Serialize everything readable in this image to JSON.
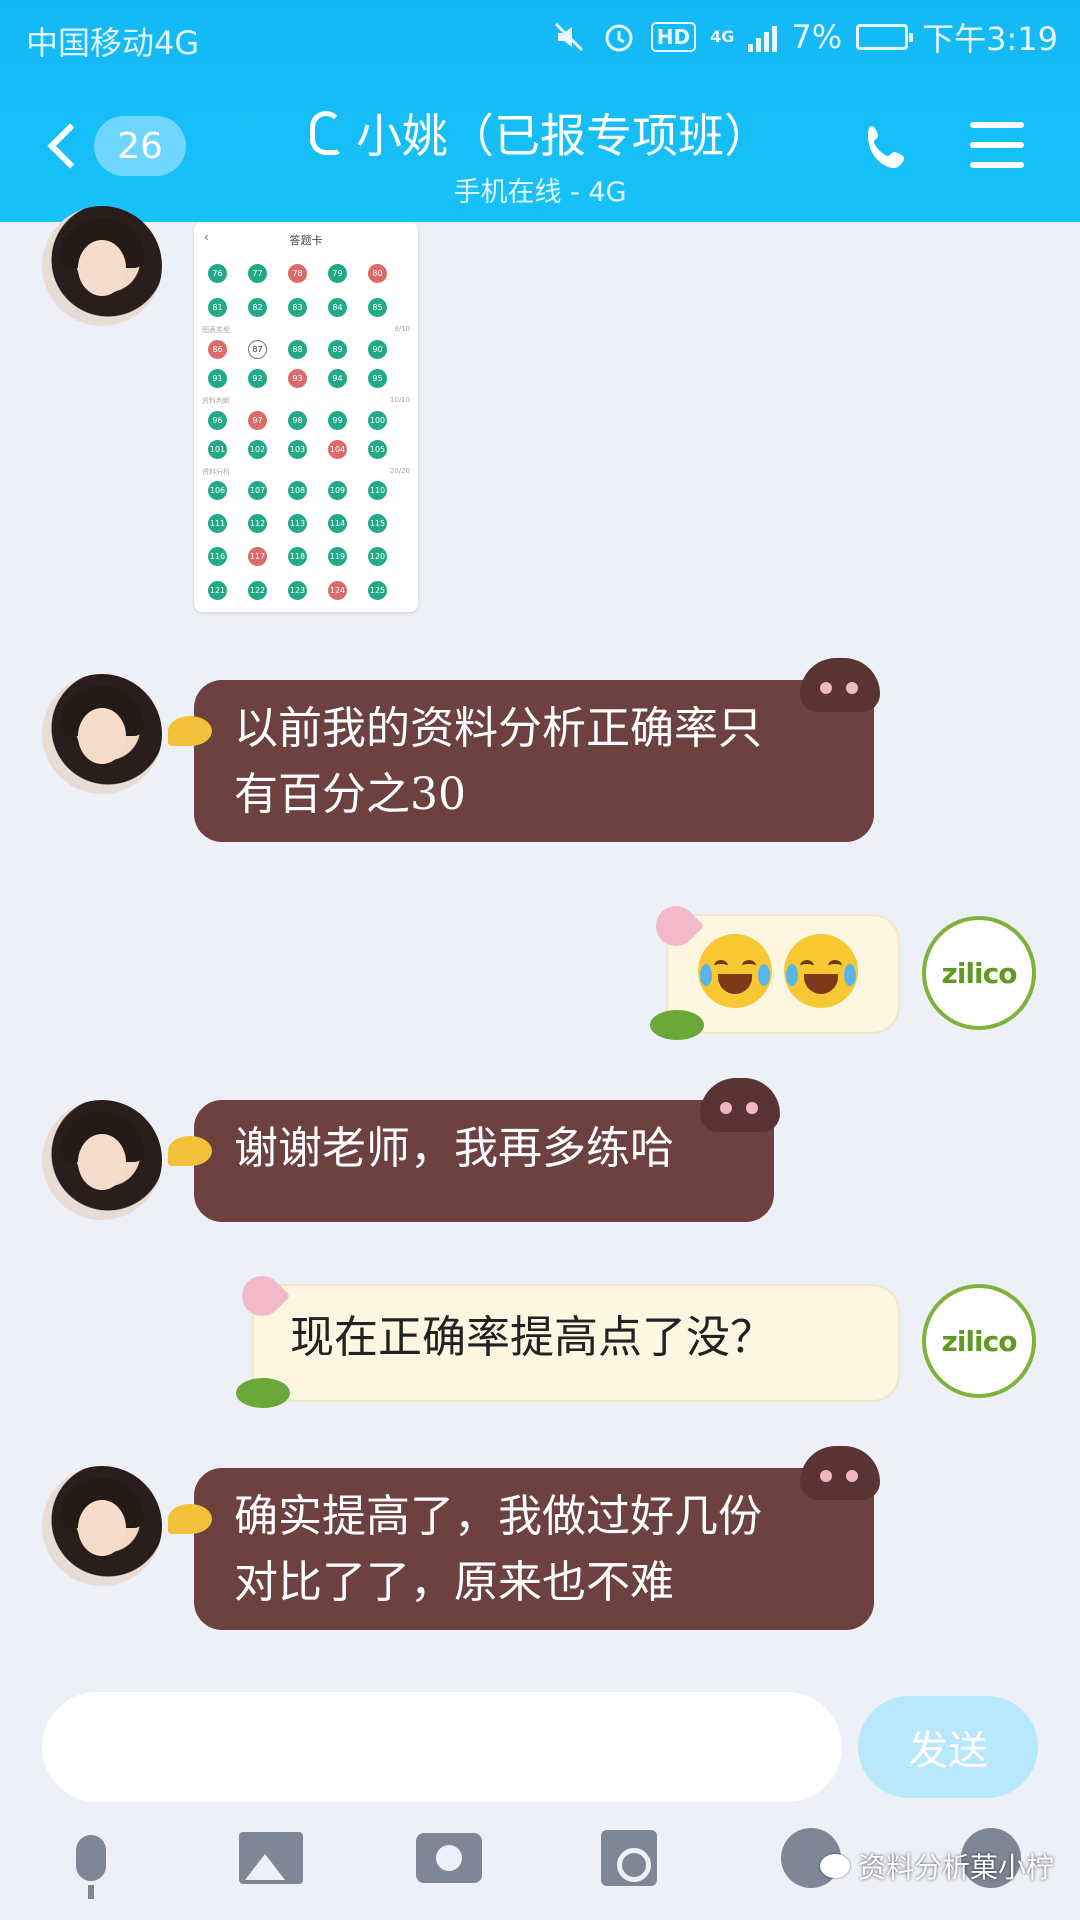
{
  "status_bar": {
    "carrier": "中国移动4G",
    "net_label": "4G",
    "hd_label": "HD",
    "battery": "7%",
    "time": "下午3:19"
  },
  "header": {
    "unread_count": "26",
    "title": "小姚（已报专项班）",
    "subtitle": "手机在线 - 4G"
  },
  "answer_card": {
    "title": "答题卡",
    "sections": [
      {
        "label": "图表类型",
        "score": "9/10"
      },
      {
        "label": "资料判断",
        "score": "10/10"
      },
      {
        "label": "资料分析",
        "score": "20/20"
      }
    ],
    "rows": [
      [
        {
          "n": "76",
          "s": "g"
        },
        {
          "n": "77",
          "s": "g"
        },
        {
          "n": "78",
          "s": "r"
        },
        {
          "n": "79",
          "s": "g"
        },
        {
          "n": "80",
          "s": "r"
        }
      ],
      [
        {
          "n": "81",
          "s": "g"
        },
        {
          "n": "82",
          "s": "g"
        },
        {
          "n": "83",
          "s": "g"
        },
        {
          "n": "84",
          "s": "g"
        },
        {
          "n": "85",
          "s": "g"
        }
      ],
      [
        {
          "n": "86",
          "s": "r"
        },
        {
          "n": "87",
          "s": "o"
        },
        {
          "n": "88",
          "s": "g"
        },
        {
          "n": "89",
          "s": "g"
        },
        {
          "n": "90",
          "s": "g"
        }
      ],
      [
        {
          "n": "91",
          "s": "g"
        },
        {
          "n": "92",
          "s": "g"
        },
        {
          "n": "93",
          "s": "r"
        },
        {
          "n": "94",
          "s": "g"
        },
        {
          "n": "95",
          "s": "g"
        }
      ],
      [
        {
          "n": "96",
          "s": "g"
        },
        {
          "n": "97",
          "s": "r"
        },
        {
          "n": "98",
          "s": "g"
        },
        {
          "n": "99",
          "s": "g"
        },
        {
          "n": "100",
          "s": "g"
        }
      ],
      [
        {
          "n": "101",
          "s": "g"
        },
        {
          "n": "102",
          "s": "g"
        },
        {
          "n": "103",
          "s": "g"
        },
        {
          "n": "104",
          "s": "r"
        },
        {
          "n": "105",
          "s": "g"
        }
      ],
      [
        {
          "n": "106",
          "s": "g"
        },
        {
          "n": "107",
          "s": "g"
        },
        {
          "n": "108",
          "s": "g"
        },
        {
          "n": "109",
          "s": "g"
        },
        {
          "n": "110",
          "s": "g"
        }
      ],
      [
        {
          "n": "111",
          "s": "g"
        },
        {
          "n": "112",
          "s": "g"
        },
        {
          "n": "113",
          "s": "g"
        },
        {
          "n": "114",
          "s": "g"
        },
        {
          "n": "115",
          "s": "g"
        }
      ],
      [
        {
          "n": "116",
          "s": "g"
        },
        {
          "n": "117",
          "s": "r"
        },
        {
          "n": "118",
          "s": "g"
        },
        {
          "n": "119",
          "s": "g"
        },
        {
          "n": "120",
          "s": "g"
        }
      ],
      [
        {
          "n": "121",
          "s": "g"
        },
        {
          "n": "122",
          "s": "g"
        },
        {
          "n": "123",
          "s": "g"
        },
        {
          "n": "124",
          "s": "r"
        },
        {
          "n": "125",
          "s": "g"
        }
      ]
    ]
  },
  "messages": {
    "m1_line1": "以前我的资料分析正确率只",
    "m1_line2": "有百分之30",
    "m3": "谢谢老师，我再多练哈",
    "m4": "现在正确率提高点了没？",
    "m5_line1": "确实提高了，我做过好几份",
    "m5_line2": "对比了了，原来也不难"
  },
  "logo_text": "zilico",
  "input": {
    "placeholder": "",
    "send_label": "发送"
  },
  "watermark": "资料分析菓小柠",
  "colors": {
    "header": "#13b8f5",
    "left_bubble": "#6d4140",
    "right_bubble": "#fdf7e2",
    "correct": "#22a988",
    "wrong": "#dd6a6a"
  }
}
